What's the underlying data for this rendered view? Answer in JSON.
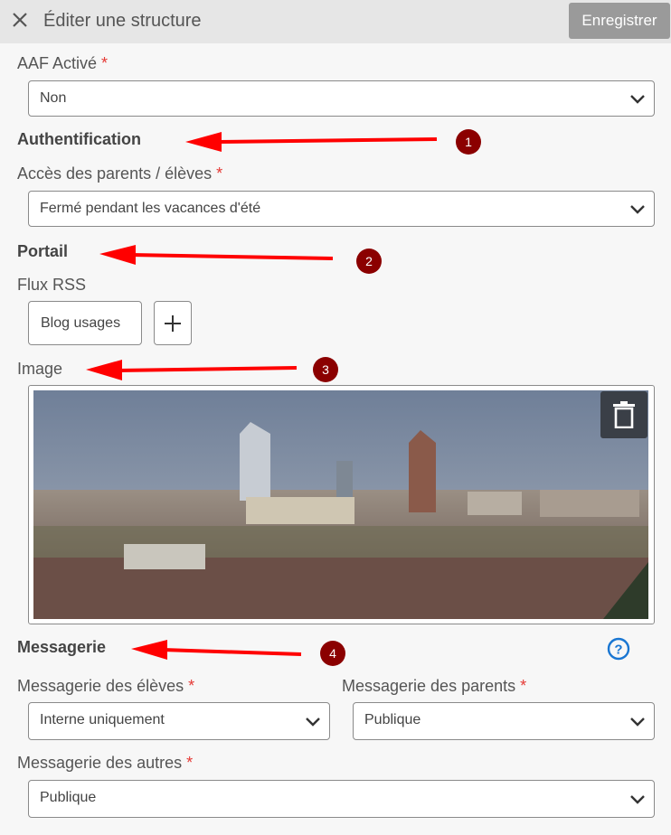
{
  "header": {
    "title": "Éditer une structure",
    "save_label": "Enregistrer"
  },
  "required_mark": "*",
  "aaf": {
    "label": "AAF Activé",
    "value": "Non"
  },
  "auth": {
    "section": "Authentification",
    "access_label": "Accès des parents / élèves",
    "access_value": "Fermé pendant les vacances d'été"
  },
  "portail": {
    "section": "Portail",
    "rss_label": "Flux RSS",
    "rss_item": "Blog usages",
    "add_symbol": "+"
  },
  "image": {
    "label": "Image"
  },
  "messagerie": {
    "section": "Messagerie",
    "eleves_label": "Messagerie des élèves",
    "eleves_value": "Interne uniquement",
    "parents_label": "Messagerie des parents",
    "parents_value": "Publique",
    "autres_label": "Messagerie des autres",
    "autres_value": "Publique"
  },
  "annotations": [
    "1",
    "2",
    "3",
    "4"
  ],
  "colors": {
    "header_bg": "#e6e6e6",
    "save_bg": "#9a9a9a",
    "required": "#e53935",
    "annotation_arrow": "#ff0000",
    "annotation_badge": "#8b0000",
    "help": "#1976d2"
  }
}
